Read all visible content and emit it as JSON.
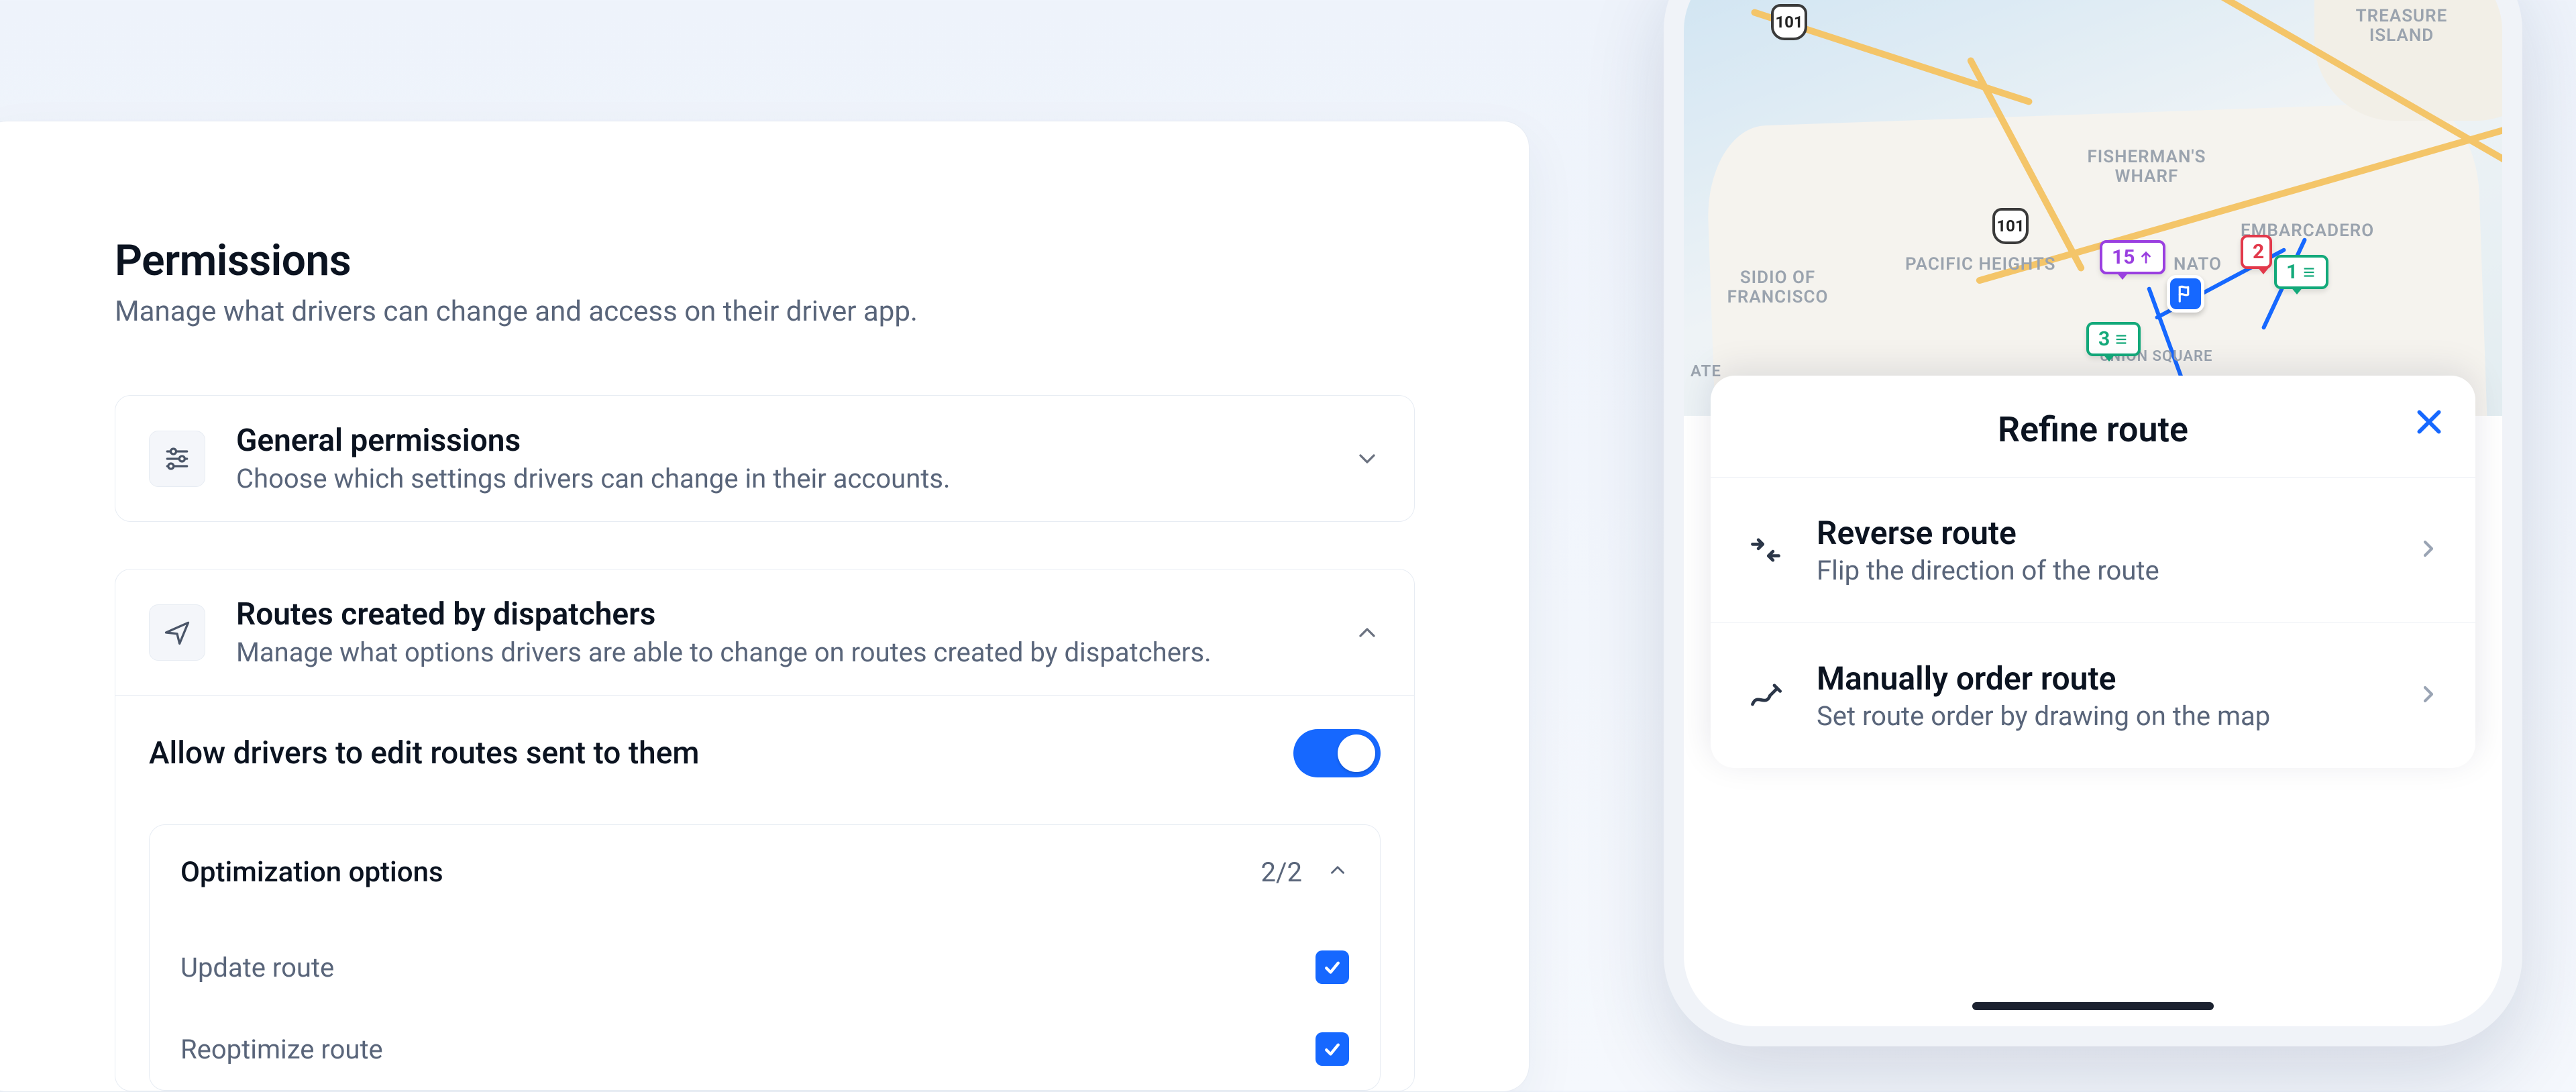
{
  "permissions": {
    "title": "Permissions",
    "subtitle": "Manage what drivers can change and access on their driver app.",
    "general": {
      "title": "General permissions",
      "subtitle": "Choose which settings drivers can change in their accounts."
    },
    "dispatch": {
      "title": "Routes created by dispatchers",
      "subtitle": "Manage what options drivers are able to change on routes created by dispatchers.",
      "toggle_label": "Allow drivers to edit routes sent to them",
      "optimization": {
        "title": "Optimization options",
        "counter": "2/2",
        "options": {
          "update": "Update route",
          "reoptimize": "Reoptimize route"
        }
      }
    }
  },
  "phone": {
    "sheet_title": "Refine route",
    "reverse": {
      "title": "Reverse route",
      "sub": "Flip the direction of the route"
    },
    "manual": {
      "title": "Manually order route",
      "sub": "Set route order by drawing on the map"
    },
    "map_labels": {
      "treasure": "TREASURE ISLAND",
      "fisher": "FISHERMAN'S WHARF",
      "embarc": "EMBARCADERO",
      "pac": "PACIFIC HEIGHTS",
      "nato": "NATO",
      "sidio": "SIDIO OF FRANCISCO",
      "union": "UNION SQUARE",
      "ate": "ate"
    },
    "map_pins": {
      "p15": "15",
      "p2": "2",
      "p1": "1",
      "p3": "3"
    },
    "road_101": "101"
  }
}
